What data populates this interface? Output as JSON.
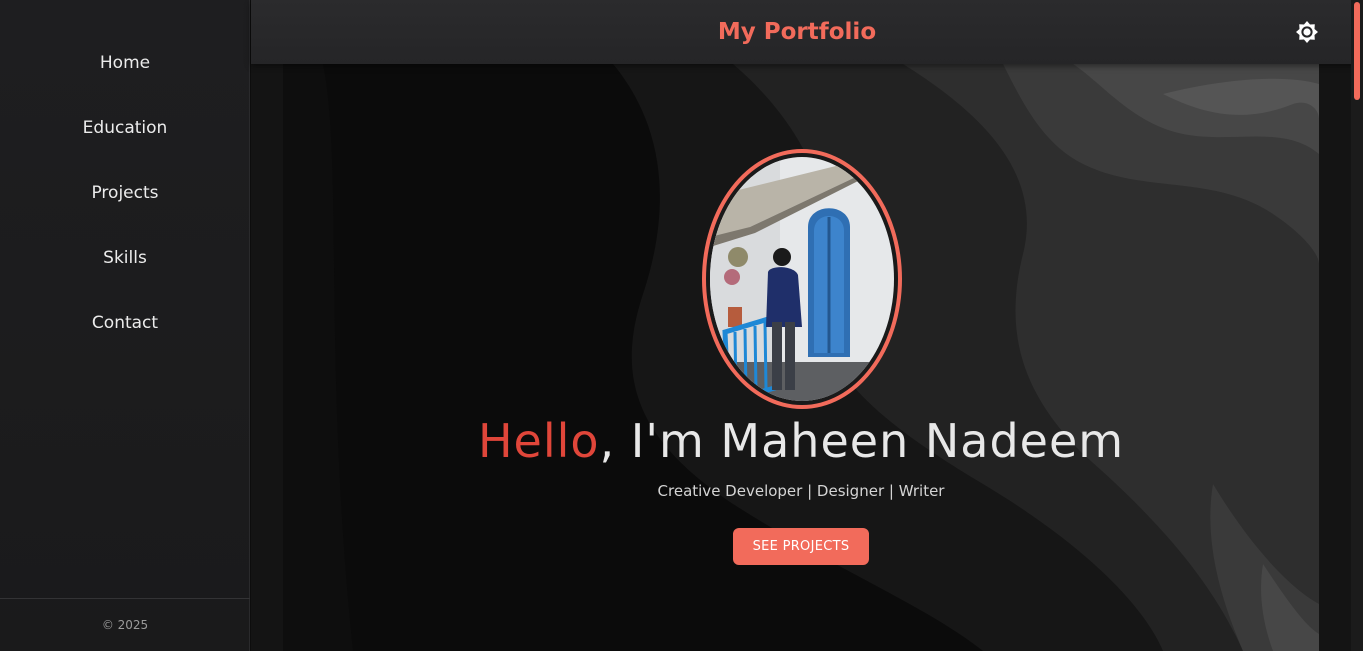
{
  "sidebar": {
    "items": [
      {
        "label": "Home"
      },
      {
        "label": "Education"
      },
      {
        "label": "Projects"
      },
      {
        "label": "Skills"
      },
      {
        "label": "Contact"
      }
    ],
    "footer": "© 2025"
  },
  "header": {
    "title": "My Portfolio",
    "theme_toggle_icon": "sun-icon"
  },
  "hero": {
    "greeting": "Hello",
    "name_line": ", I'm Maheen Nadeem",
    "subtitle": "Creative Developer | Designer | Writer",
    "cta_label": "SEE PROJECTS",
    "photo_icon": "profile-photo"
  },
  "colors": {
    "accent": "#f26b5b",
    "greeting": "#e0463a",
    "sidebar_bg": "#1e1e20",
    "header_bg": "#2b2b2d",
    "hero_bg": "#0b0b0b"
  }
}
